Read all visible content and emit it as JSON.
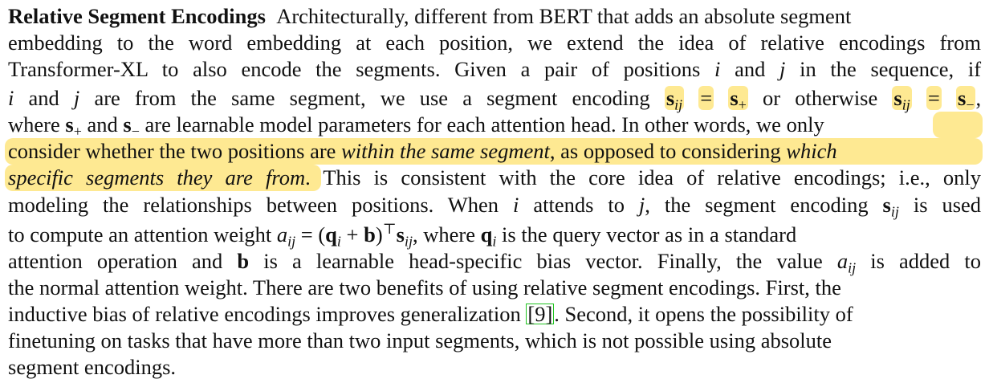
{
  "paragraph": {
    "heading": "Relative Segment Encodings",
    "line1": "Architecturally, different from BERT that adds an absolute segment",
    "line2": "embedding to the word embedding at each position, we extend the idea of relative encodings from",
    "line3a": "Transformer-XL to also encode the segments. Given a pair of positions",
    "line3b": "and",
    "line3c": "in the sequence, if",
    "line4a": "and",
    "line4b": "are from the same segment, we use a segment encoding",
    "line4c": "or otherwise",
    "line5a": "where",
    "line5b": "and",
    "line5c": "are learnable model parameters for each attention head. In other words, we",
    "line5d": "only",
    "line6a": "consider whether the two positions are",
    "line6b": "within the same segment",
    "line6c": ", as opposed to considering",
    "line6d": "which",
    "line7a": "specific segments they are from",
    "line7b": ". This is consistent with the core idea of relative encodings; i.e., only",
    "line8": "modeling the relationships between positions. When",
    "line8b": "attends to",
    "line8c": ", the segment encoding",
    "line8d": "is used",
    "line9a": "to compute an attention weight",
    "line9b": ", where",
    "line9c": "is the query vector as in a standard",
    "line10a": "attention operation and",
    "line10b": "is a learnable head-specific bias vector. Finally, the value",
    "line10c": "is added to",
    "line11": "the normal attention weight. There are two benefits of using relative segment encodings. First, the",
    "line12a": "inductive bias of relative encodings improves generalization",
    "line12b": ". Second, it opens the possibility of",
    "line13": "finetuning on tasks that have more than two input segments, which is not possible using absolute",
    "line14": "segment encodings.",
    "citation": "9"
  },
  "math": {
    "i": "i",
    "j": "j",
    "s": "s",
    "ij": "ij",
    "plus": "+",
    "minus": "−",
    "eq": "=",
    "a": "a",
    "q": "q",
    "b": "b",
    "top": "⊤",
    "lparen": "(",
    "rparen": ")",
    "comma": ","
  },
  "colors": {
    "highlight": "#fde16e",
    "citation_border": "#22c422"
  }
}
